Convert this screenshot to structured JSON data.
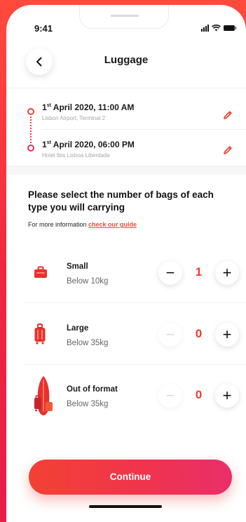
{
  "status_bar": {
    "time": "9:41"
  },
  "header": {
    "title": "Luggage"
  },
  "route": {
    "departure": {
      "datetime": "1st April 2020, 11:00 AM",
      "ordinal": "st",
      "prefix": "1",
      "rest": " April 2020, 11:00 AM",
      "location": "Lisbon Airport, Terminal 2"
    },
    "arrival": {
      "datetime": "1st April 2020, 06:00 PM",
      "ordinal": "st",
      "prefix": "1",
      "rest": " April 2020, 06:00 PM",
      "location": "Hotel Ibis Lisboa Liberdade"
    }
  },
  "prompt": "Please select the number of bags of each type you will carrying",
  "more_info": {
    "text": "For more information ",
    "link": "check our guide"
  },
  "bags": [
    {
      "name": "Small",
      "limit": "Below 10kg",
      "count": "1",
      "icon": "small-bag-icon",
      "minus_enabled": true
    },
    {
      "name": "Large",
      "limit": "Below 35kg",
      "count": "0",
      "icon": "suitcase-icon",
      "minus_enabled": false
    },
    {
      "name": "Out of format",
      "limit": "Below 35kg",
      "count": "0",
      "icon": "surfboard-luggage-icon",
      "minus_enabled": false
    }
  ],
  "stepper": {
    "minus": "−",
    "plus": "+"
  },
  "continue_label": "Continue",
  "colors": {
    "accent": "#f04a3a",
    "accent_pink": "#e8305e",
    "background": "#ff4a3d"
  }
}
